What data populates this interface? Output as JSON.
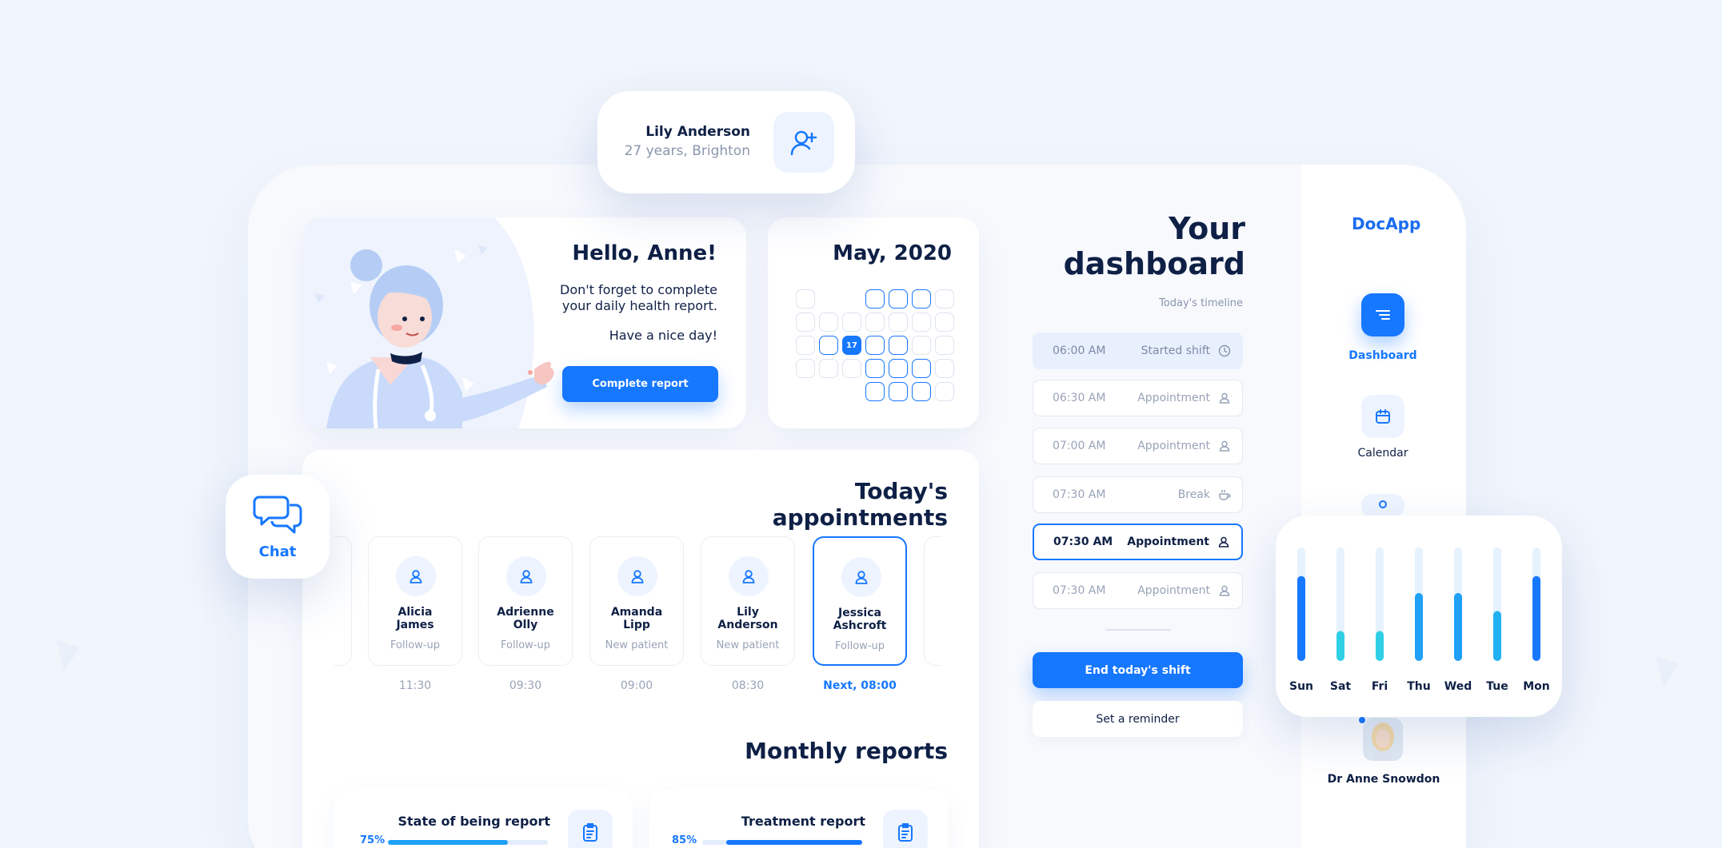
{
  "app": {
    "brand": "DocApp"
  },
  "sidebar": {
    "items": [
      {
        "label": "Dashboard",
        "icon": "menu-lines-icon",
        "active": true
      },
      {
        "label": "Calendar",
        "icon": "calendar-icon",
        "active": false
      }
    ],
    "doctor_name": "Dr Anne Snowdon"
  },
  "dashboard": {
    "title_line1": "Your",
    "title_line2": "dashboard",
    "timeline_label": "Today's timeline",
    "timeline": [
      {
        "label": "Started shift",
        "time": "06:00 AM",
        "icon": "clock-icon",
        "state": "started"
      },
      {
        "label": "Appointment",
        "time": "06:30 AM",
        "icon": "user-icon",
        "state": "past"
      },
      {
        "label": "Appointment",
        "time": "07:00 AM",
        "icon": "user-icon",
        "state": "past"
      },
      {
        "label": "Break",
        "time": "07:30 AM",
        "icon": "coffee-icon",
        "state": "past"
      },
      {
        "label": "Appointment",
        "time": "07:30 AM",
        "icon": "user-icon",
        "state": "current"
      },
      {
        "label": "Appointment",
        "time": "07:30 AM",
        "icon": "user-icon",
        "state": "upcoming"
      }
    ],
    "end_shift_label": "End today's shift",
    "reminder_label": "Set a reminder"
  },
  "calendar": {
    "title": "May, 2020",
    "today": "17"
  },
  "greeting": {
    "title": "Hello, Anne!",
    "line1": "Don't forget to complete",
    "line2": "your daily health report.",
    "line3": "Have a nice day!",
    "button": "Complete report"
  },
  "patient": {
    "name": "Lily Anderson",
    "info": "27 years, Brighton"
  },
  "chat": {
    "label": "Chat"
  },
  "appointments": {
    "title": "Today's appointments",
    "items": [
      {
        "name_line1": "Jessica",
        "name_line2": "Ashcroft",
        "type": "Follow-up",
        "time": "Next, 08:00",
        "next": true
      },
      {
        "name_line1": "Lily",
        "name_line2": "Anderson",
        "type": "New patient",
        "time": "08:30",
        "next": false
      },
      {
        "name_line1": "Amanda",
        "name_line2": "Lipp",
        "type": "New patient",
        "time": "09:00",
        "next": false
      },
      {
        "name_line1": "Adrienne",
        "name_line2": "Olly",
        "type": "Follow-up",
        "time": "09:30",
        "next": false
      },
      {
        "name_line1": "Alicia",
        "name_line2": "James",
        "type": "Follow-up",
        "time": "11:30",
        "next": false
      }
    ]
  },
  "reports": {
    "title": "Monthly reports",
    "items": [
      {
        "name": "Treatment report",
        "percent": "85%",
        "progress": 0.85,
        "color": "#1677ff"
      },
      {
        "name": "State of being report",
        "percent": "75%",
        "progress": 0.75,
        "color": "#1ea1f7"
      }
    ]
  },
  "weekly_chart": {
    "days": [
      "Mon",
      "Tue",
      "Wed",
      "Thu",
      "Fri",
      "Sat",
      "Sun"
    ],
    "levels": [
      0.85,
      0.5,
      0.68,
      0.68,
      0.3,
      0.3,
      0.85
    ],
    "colors": [
      "#1677ff",
      "#22b2f2",
      "#1ea1f7",
      "#1ea1f7",
      "#2fd0e6",
      "#2fd0e6",
      "#1677ff"
    ]
  },
  "colors": {
    "accent": "#1677ff",
    "text": "#0f2046",
    "muted": "#98a3b8"
  }
}
